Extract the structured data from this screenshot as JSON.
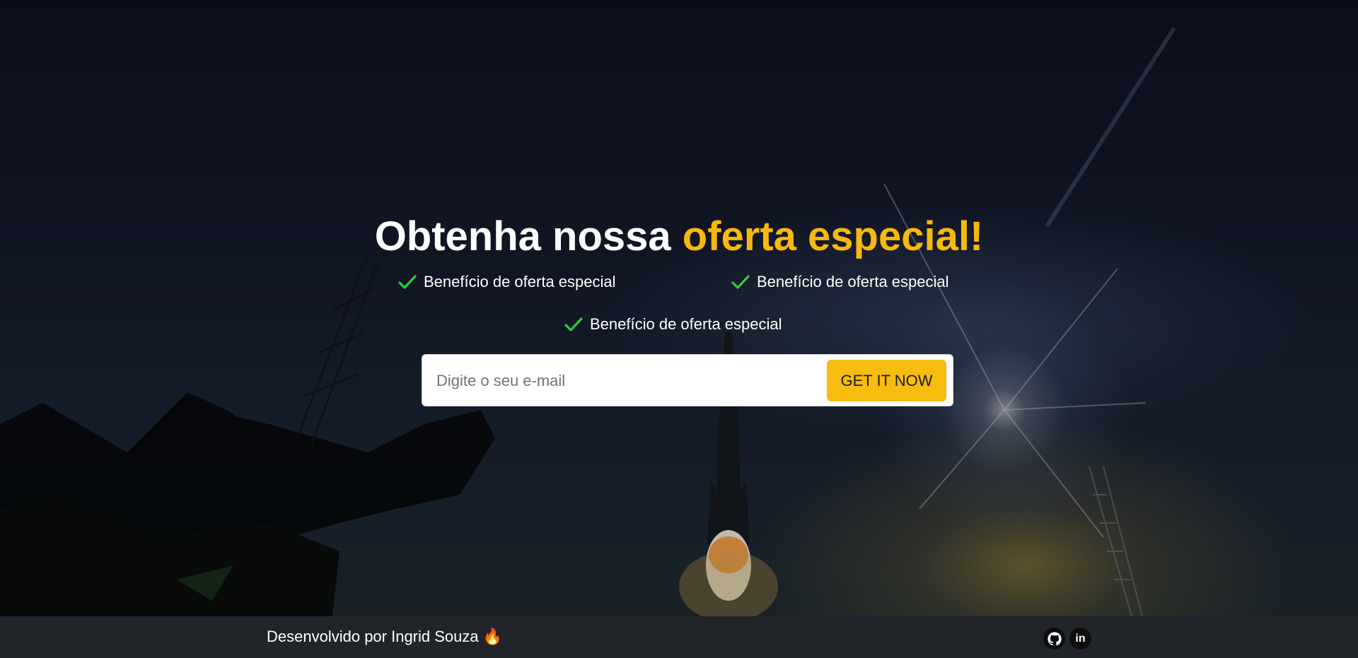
{
  "hero": {
    "headline_main": "Obtenha nossa ",
    "headline_accent": "oferta especial!",
    "benefits": [
      "Benefício de oferta especial",
      "Benefício de oferta especial",
      "Benefício de oferta especial"
    ]
  },
  "signup": {
    "email_placeholder": "Digite o seu e-mail",
    "button_label": "GET IT NOW"
  },
  "footer": {
    "credit": "Desenvolvido por Ingrid Souza 🔥",
    "social": [
      {
        "icon": "github-icon"
      },
      {
        "icon": "linkedin-icon",
        "glyph": "in"
      }
    ]
  },
  "colors": {
    "accent": "#f7b80f",
    "button": "#f7bc10",
    "check": "#2ecc40",
    "footer_bg": "#212529"
  }
}
